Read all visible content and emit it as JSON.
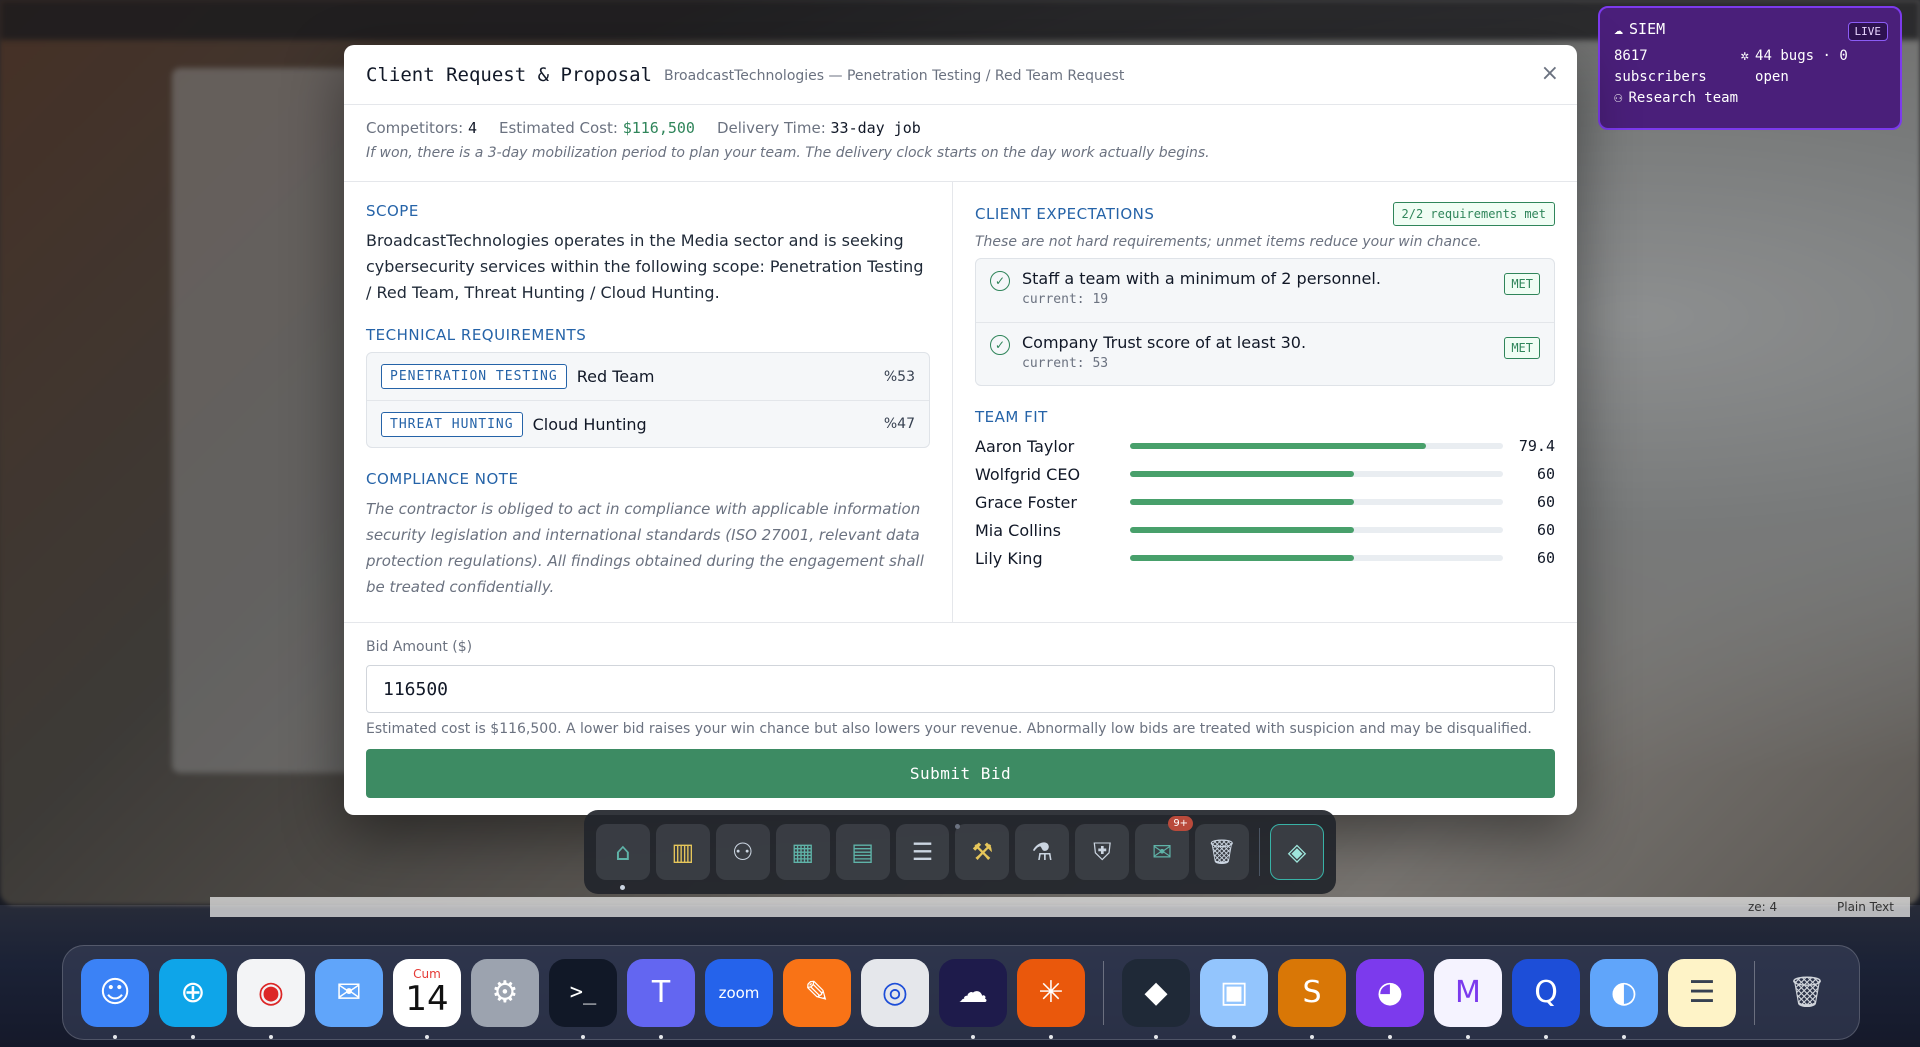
{
  "siem": {
    "title": "SIEM",
    "live": "LIVE",
    "subscribers_count": "8617",
    "subscribers_label": "subscribers",
    "bugs": "44 bugs · 0 open",
    "team": "Research team",
    "accent": "#7c3aed"
  },
  "modal": {
    "title": "Client Request & Proposal",
    "subtitle": "BroadcastTechnologies — Penetration Testing / Red Team Request",
    "close_icon": "×",
    "meta": {
      "competitors_label": "Competitors:",
      "competitors": "4",
      "cost_label": "Estimated Cost:",
      "cost": "$116,500",
      "delivery_label": "Delivery Time:",
      "delivery": "33-day job",
      "note": "If won, there is a 3-day mobilization period to plan your team. The delivery clock starts on the day work actually begins."
    },
    "scope": {
      "title": "SCOPE",
      "text": "BroadcastTechnologies operates in the Media sector and is seeking cybersecurity services within the following scope: Penetration Testing / Red Team, Threat Hunting / Cloud Hunting."
    },
    "technical": {
      "title": "TECHNICAL REQUIREMENTS",
      "items": [
        {
          "tag": "PENETRATION TESTING",
          "name": "Red Team",
          "pct": "%53"
        },
        {
          "tag": "THREAT HUNTING",
          "name": "Cloud Hunting",
          "pct": "%47"
        }
      ]
    },
    "compliance": {
      "title": "COMPLIANCE NOTE",
      "text": "The contractor is obliged to act in compliance with applicable information security legislation and international standards (ISO 27001, relevant data protection regulations). All findings obtained during the engagement shall be treated confidentially."
    },
    "expectations": {
      "title": "CLIENT EXPECTATIONS",
      "badge": "2/2 requirements met",
      "note": "These are not hard requirements; unmet items reduce your win chance.",
      "items": [
        {
          "text": "Staff a team with a minimum of 2 personnel.",
          "current": "current: 19",
          "status": "MET"
        },
        {
          "text": "Company Trust score of at least 30.",
          "current": "current: 53",
          "status": "MET"
        }
      ]
    },
    "team_fit": {
      "title": "TEAM FIT",
      "members": [
        {
          "name": "Aaron Taylor",
          "value": "79.4",
          "fraction": 0.794
        },
        {
          "name": "Wolfgrid CEO",
          "value": "60",
          "fraction": 0.6
        },
        {
          "name": "Grace Foster",
          "value": "60",
          "fraction": 0.6
        },
        {
          "name": "Mia Collins",
          "value": "60",
          "fraction": 0.6
        },
        {
          "name": "Lily King",
          "value": "60",
          "fraction": 0.6
        }
      ]
    },
    "bid": {
      "label": "Bid Amount ($)",
      "value": "116500",
      "hint": "Estimated cost is $116,500. A lower bid raises your win chance but also lowers your revenue. Abnormally low bids are treated with suspicion and may be disqualified.",
      "submit": "Submit Bid"
    }
  },
  "toolbar": {
    "items": [
      {
        "icon": "store-icon"
      },
      {
        "icon": "kanban-icon"
      },
      {
        "icon": "users-icon"
      },
      {
        "icon": "calculator-icon"
      },
      {
        "icon": "building-icon"
      },
      {
        "icon": "server-icon"
      },
      {
        "icon": "hammer-icon"
      },
      {
        "icon": "flask-icon"
      },
      {
        "icon": "shield-icon"
      },
      {
        "icon": "mail-icon",
        "badge": "9+"
      },
      {
        "icon": "trash-icon"
      },
      {
        "icon": "layers-icon"
      }
    ]
  },
  "dock": {
    "calendar_month": "Cum",
    "calendar_day": "14",
    "zoom_label": "zoom"
  },
  "background": {
    "status_right_1": "ze: 4",
    "status_right_2": "Plain Text"
  }
}
